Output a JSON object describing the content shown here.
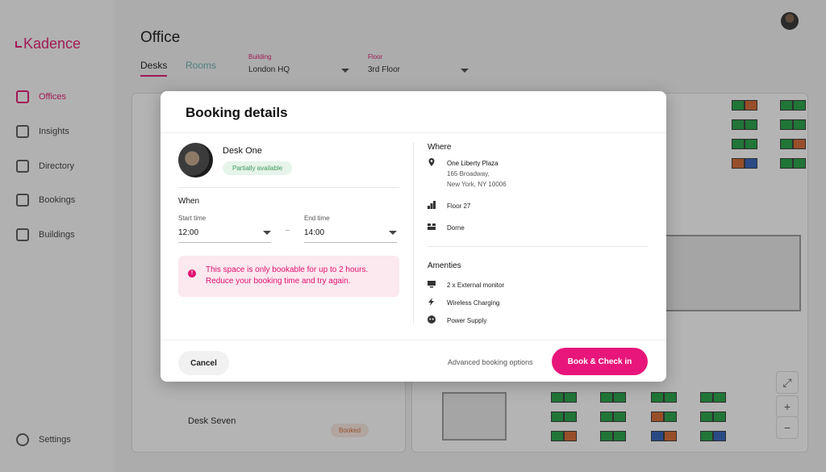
{
  "app": {
    "brand": "Kadence",
    "page_title": "Office"
  },
  "sidebar": {
    "items": [
      {
        "label": "Offices",
        "icon": "office-icon",
        "active": true
      },
      {
        "label": "Insights",
        "icon": "insights-icon",
        "active": false
      },
      {
        "label": "Directory",
        "icon": "directory-icon",
        "active": false
      },
      {
        "label": "Bookings",
        "icon": "bookings-icon",
        "active": false
      },
      {
        "label": "Buildings",
        "icon": "buildings-icon",
        "active": false
      }
    ],
    "settings_label": "Settings"
  },
  "tabs": [
    {
      "label": "Desks",
      "active": true
    },
    {
      "label": "Rooms",
      "active": false
    }
  ],
  "filters": {
    "building": {
      "label": "Building",
      "value": "London HQ"
    },
    "floor": {
      "label": "Floor",
      "value": "3rd Floor"
    }
  },
  "background_list": {
    "desk_seven": {
      "name": "Desk Seven",
      "status": "Booked"
    }
  },
  "modal": {
    "title": "Booking details",
    "desk": {
      "name": "Desk One",
      "availability": "Partially available"
    },
    "when": {
      "heading": "When",
      "start": {
        "label": "Start time",
        "value": "12:00"
      },
      "separator": "–",
      "end": {
        "label": "End time",
        "value": "14:00"
      }
    },
    "alert": {
      "line1": "This space is only bookable for up to 2 hours.",
      "line2": "Reduce your booking time and try again."
    },
    "where": {
      "heading": "Where",
      "address_name": "One Liberty Plaza",
      "address_street": "165 Broadway,",
      "address_city": "New York, NY 10006",
      "floor": "Floor 27",
      "zone": "Dorne"
    },
    "amenities": {
      "heading": "Amenties",
      "items": [
        "2 x External monitor",
        "Wireless Charging",
        "Power Supply"
      ]
    },
    "footer": {
      "cancel": "Cancel",
      "advanced": "Advanced booking options",
      "book": "Book & Check in"
    }
  },
  "colors": {
    "accent": "#e8167a",
    "available": "#1e9e3f",
    "partial": "#d4652a",
    "booked": "#2b5db8"
  }
}
